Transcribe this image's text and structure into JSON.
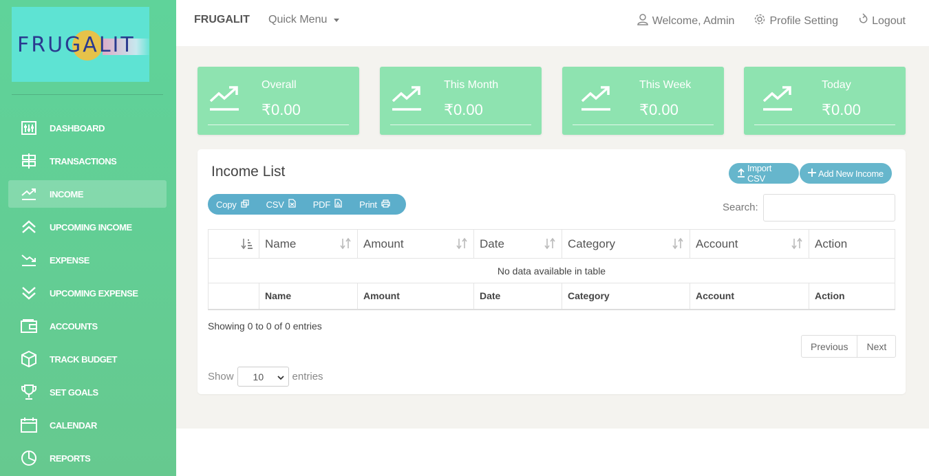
{
  "logo": {
    "text": "FRUGALIT"
  },
  "sidebar": {
    "items": [
      {
        "label": "DASHBOARD",
        "icon": "dashboard-sliders-icon"
      },
      {
        "label": "TRANSACTIONS",
        "icon": "signpost-icon"
      },
      {
        "label": "INCOME",
        "icon": "trend-up-icon",
        "active": true
      },
      {
        "label": "UPCOMING INCOME",
        "icon": "double-chevron-up-icon"
      },
      {
        "label": "EXPENSE",
        "icon": "trend-down-icon"
      },
      {
        "label": "UPCOMING EXPENSE",
        "icon": "double-chevron-down-icon"
      },
      {
        "label": "ACCOUNTS",
        "icon": "wallet-icon"
      },
      {
        "label": "TRACK BUDGET",
        "icon": "box-icon"
      },
      {
        "label": "SET GOALS",
        "icon": "trophy-icon"
      },
      {
        "label": "CALENDAR",
        "icon": "calendar-icon"
      },
      {
        "label": "REPORTS",
        "icon": "pie-chart-icon"
      }
    ]
  },
  "topbar": {
    "brand": "FRUGALIT",
    "quick_menu": "Quick Menu",
    "welcome": "Welcome, Admin",
    "profile": "Profile Setting",
    "logout": "Logout"
  },
  "stats": [
    {
      "label": "Overall",
      "value": "₹0.00"
    },
    {
      "label": "This Month",
      "value": "₹0.00"
    },
    {
      "label": "This Week",
      "value": "₹0.00"
    },
    {
      "label": "Today",
      "value": "₹0.00"
    }
  ],
  "income_list": {
    "title": "Income List",
    "import_label": "Import CSV",
    "add_label": "Add New Income",
    "export": {
      "copy": "Copy",
      "csv": "CSV",
      "pdf": "PDF",
      "print": "Print"
    },
    "search_label": "Search:",
    "columns": [
      "Name",
      "Amount",
      "Date",
      "Category",
      "Account",
      "Action"
    ],
    "empty_message": "No data available in table",
    "info": "Showing 0 to 0 of 0 entries",
    "previous": "Previous",
    "next": "Next",
    "show_label": "Show",
    "entries_label": "entries",
    "page_length": "10"
  },
  "colors": {
    "sidebar": "#5fd39a",
    "stat_card": "#8ee3b0",
    "accent_button": "#66b6cc",
    "background": "#f4f3ef"
  }
}
